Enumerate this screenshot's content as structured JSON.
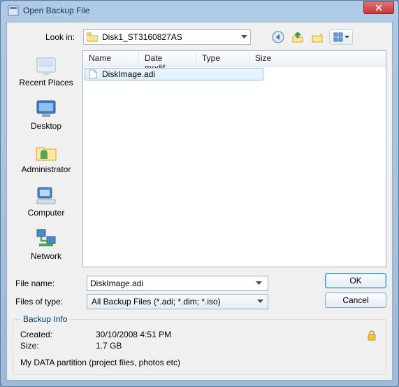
{
  "window": {
    "title": "Open Backup File"
  },
  "lookin": {
    "label": "Look in:",
    "value": "Disk1_ST3160827AS",
    "nav": {
      "back": "back-icon",
      "up": "up-one-level-icon",
      "newfolder": "new-folder-icon",
      "views": "view-menu-icon"
    }
  },
  "places": [
    {
      "key": "recent",
      "label": "Recent Places"
    },
    {
      "key": "desktop",
      "label": "Desktop"
    },
    {
      "key": "admin",
      "label": "Administrator"
    },
    {
      "key": "computer",
      "label": "Computer"
    },
    {
      "key": "network",
      "label": "Network"
    }
  ],
  "columns": {
    "name": "Name",
    "date": "Date modif...",
    "type": "Type",
    "size": "Size"
  },
  "files": [
    {
      "name": "DiskImage.adi"
    }
  ],
  "filename": {
    "label": "File name:",
    "value": "DiskImage.adi"
  },
  "filetype": {
    "label": "Files of type:",
    "value": "All Backup Files (*.adi; *.dim; *.iso)"
  },
  "buttons": {
    "ok": "OK",
    "cancel": "Cancel"
  },
  "group": {
    "legend": "Backup Info",
    "created_label": "Created:",
    "created_value": "30/10/2008 4:51 PM",
    "size_label": "Size:",
    "size_value": "1.7 GB",
    "description": "My DATA partition (project files, photos etc)",
    "locked": true
  }
}
